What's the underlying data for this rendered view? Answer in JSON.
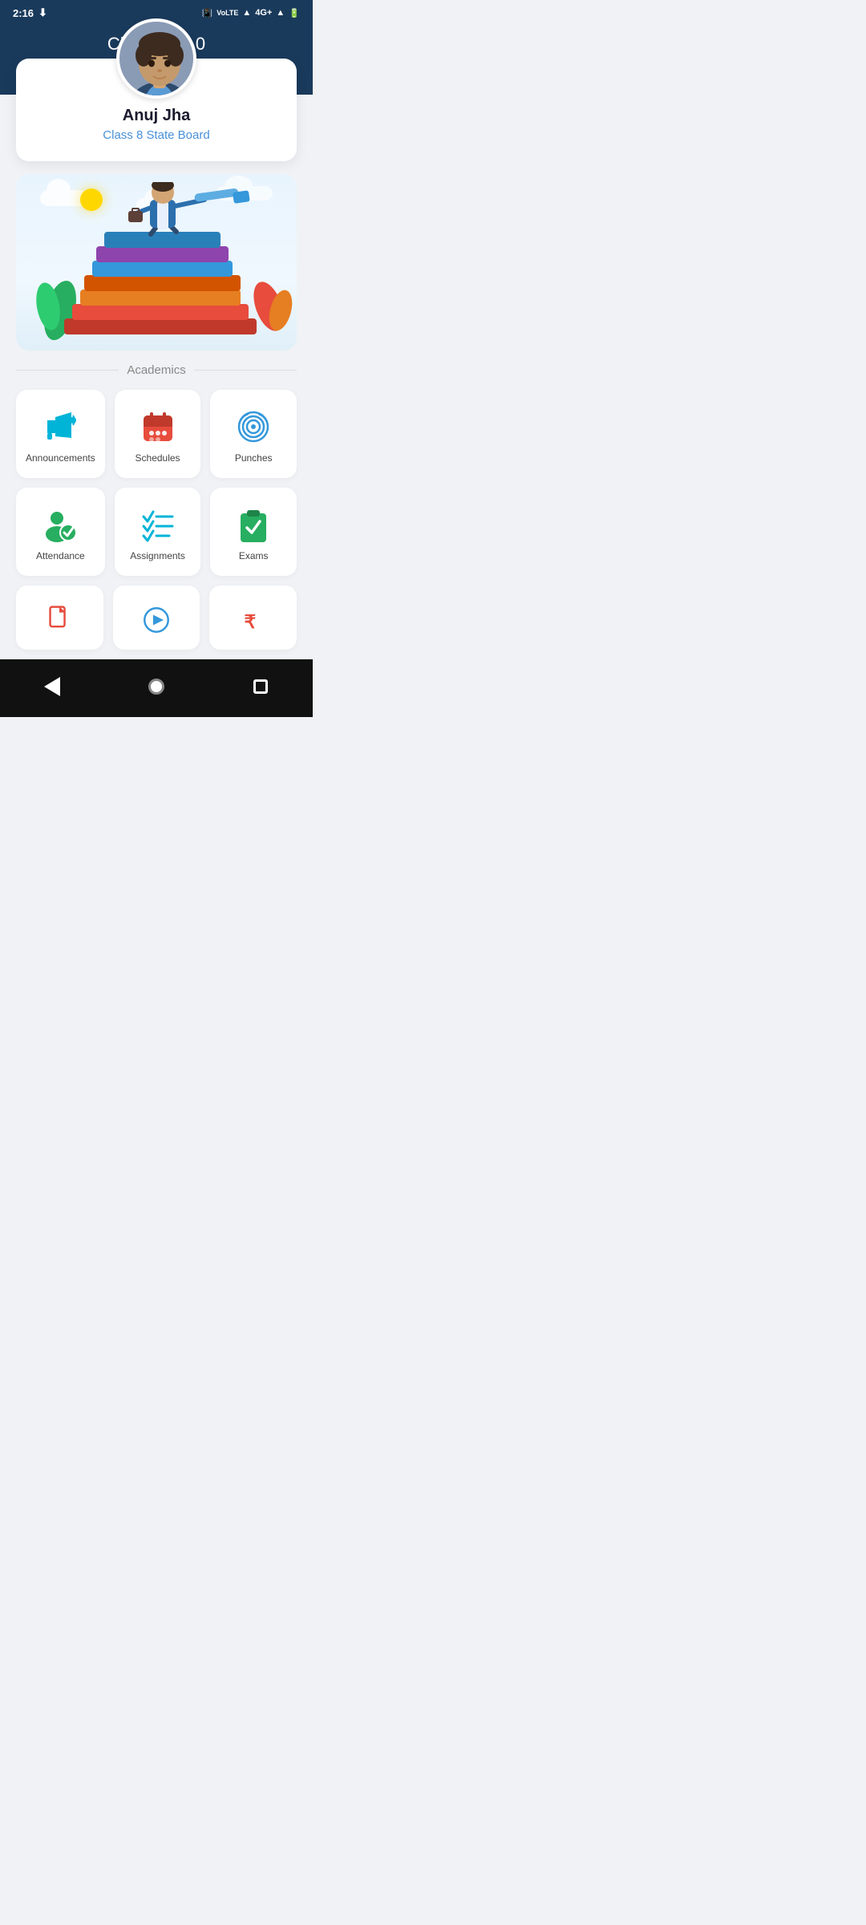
{
  "statusBar": {
    "time": "2:16",
    "downloadIcon": "↓",
    "wifiIcon": "wifi",
    "networkIcon": "4G+"
  },
  "header": {
    "title": "Classbot 2.0"
  },
  "profile": {
    "name": "Anuj Jha",
    "class": "Class 8 State Board",
    "avatarAlt": "Anuj Jha avatar"
  },
  "sections": {
    "academics": {
      "label": "Academics"
    }
  },
  "gridItems": [
    {
      "id": "announcements",
      "label": "Announcements",
      "icon": "megaphone-icon",
      "color": "#00b4d8"
    },
    {
      "id": "schedules",
      "label": "Schedules",
      "icon": "calendar-icon",
      "color": "#e74c3c"
    },
    {
      "id": "punches",
      "label": "Punches",
      "icon": "fingerprint-icon",
      "color": "#3498db"
    },
    {
      "id": "attendance",
      "label": "Attendance",
      "icon": "attendance-icon",
      "color": "#27ae60"
    },
    {
      "id": "assignments",
      "label": "Assignments",
      "icon": "list-check-icon",
      "color": "#00b4d8"
    },
    {
      "id": "exams",
      "label": "Exams",
      "icon": "clipboard-icon",
      "color": "#27ae60"
    }
  ],
  "bottomRowItems": [
    {
      "id": "item7",
      "label": "",
      "icon": "document-icon",
      "color": "#e74c3c"
    },
    {
      "id": "item8",
      "label": "",
      "icon": "play-icon",
      "color": "#3498db"
    },
    {
      "id": "item9",
      "label": "",
      "icon": "rupee-icon",
      "color": "#e74c3c"
    }
  ],
  "navBar": {
    "back": "back",
    "home": "home",
    "recent": "recent-apps"
  }
}
